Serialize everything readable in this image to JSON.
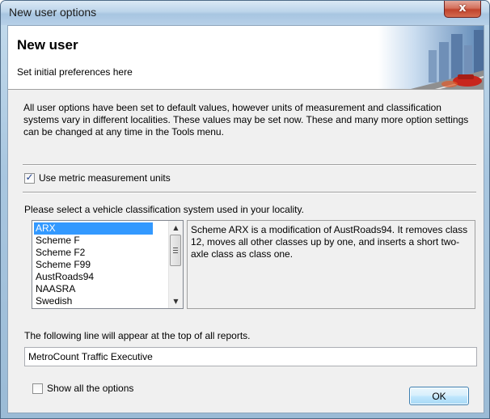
{
  "window": {
    "title": "New user options",
    "close_label": "x"
  },
  "header": {
    "title": "New user",
    "subtitle": "Set initial preferences here"
  },
  "intro": "All user options have been set to default values, however units of measurement and classification systems vary in different localities. These values may be set now. These and many more option settings can be changed at any time in the Tools menu.",
  "metric_units": {
    "label": "Use metric measurement units",
    "checked": true
  },
  "classification": {
    "prompt": "Please select a vehicle classification system used in your locality.",
    "items": [
      "ARX",
      "Scheme F",
      "Scheme F2",
      "Scheme F99",
      "AustRoads94",
      "NAASRA",
      "Swedish"
    ],
    "selected": "ARX",
    "description": "Scheme ARX is a modification of AustRoads94. It removes class 12, moves all other classes up by one, and inserts a short two-axle class as class one."
  },
  "report_header": {
    "label": "The following line will appear at the top of all reports.",
    "value": "MetroCount Traffic Executive"
  },
  "show_all": {
    "label": "Show all the options",
    "checked": false
  },
  "buttons": {
    "ok": "OK"
  },
  "colors": {
    "selection": "#3399ff",
    "titlebar": "#bcd4ea",
    "close": "#c0432c"
  }
}
